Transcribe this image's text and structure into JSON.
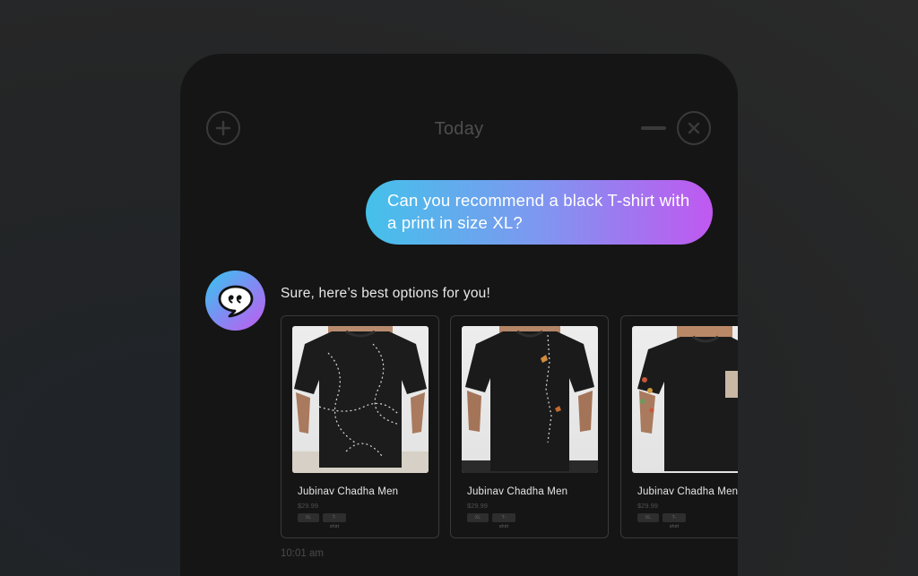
{
  "header": {
    "title": "Today"
  },
  "user_message": {
    "text": "Can you recommend a black T-shirt with a print in size XL?"
  },
  "bot_message": {
    "text": "Sure, here’s best options for you!",
    "timestamp": "10:01 am"
  },
  "products": [
    {
      "name": "Jubinav Chadha Men",
      "price": "$29.99",
      "tag1": "XL",
      "tag2": "T-shirt"
    },
    {
      "name": "Jubinav Chadha Men",
      "price": "$29.99",
      "tag1": "XL",
      "tag2": "T-shirt"
    },
    {
      "name": "Jubinav Chadha Men",
      "price": "$29.99",
      "tag1": "XL",
      "tag2": "T-shirt"
    }
  ],
  "icons": {
    "add": "plus-circle-icon",
    "minimize": "minus-icon",
    "close": "close-circle-icon",
    "avatar": "chat-bubble-icon"
  },
  "colors": {
    "background": "#242526",
    "panel": "#151515",
    "gradient_start": "#44c1ea",
    "gradient_end": "#c058f0"
  }
}
